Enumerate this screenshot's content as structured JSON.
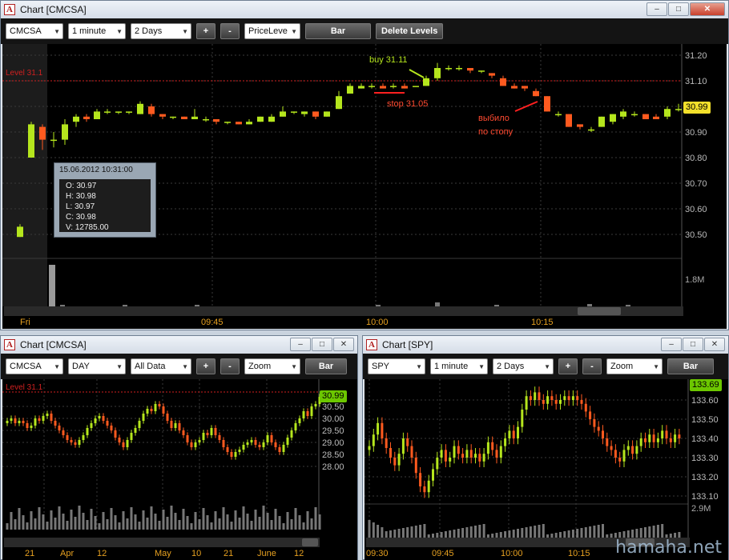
{
  "main": {
    "title": "Chart [CMCSA]",
    "symbol": "CMCSA",
    "interval": "1 minute",
    "period": "2 Days",
    "mode": "PriceLeve",
    "bar_label": "Bar",
    "delete_label": "Delete Levels",
    "plus": "+",
    "minus": "-",
    "level_label": "Level 31.1",
    "price_labels": [
      "31.20",
      "31.10",
      "31.00",
      "30.90",
      "30.80",
      "30.70",
      "30.60",
      "30.50"
    ],
    "price_values": [
      31.2,
      31.1,
      31.0,
      30.9,
      30.8,
      30.7,
      30.6,
      30.5
    ],
    "volume_label": "1.8M",
    "time_labels": [
      "Fri",
      "09:45",
      "10:00",
      "10:15"
    ],
    "current_price": "30.99",
    "buy_note": "buy 31.11",
    "stop_note": "stop 31.05",
    "hit_note_1": "выбило",
    "hit_note_2": "по стопу",
    "tooltip": {
      "title": "15.06.2012 10:31:00",
      "open": "O: 30.97",
      "high": "H: 30.98",
      "low": "L: 30.97",
      "close": "C: 30.98",
      "volume": "V:  12785.00"
    },
    "colors": {
      "up": "#b5e61d",
      "down": "#ff5a1f",
      "level": "#d02020",
      "axis": "#e6a020"
    }
  },
  "left": {
    "title": "Chart [CMCSA]",
    "symbol": "CMCSA",
    "interval": "DAY",
    "period": "All Data",
    "mode": "Zoom",
    "bar_label": "Bar",
    "plus": "+",
    "minus": "-",
    "level_label": "Level 31.1",
    "price_labels": [
      "30.50",
      "30.00",
      "29.50",
      "29.00",
      "28.50",
      "28.00"
    ],
    "current_price": "30.99",
    "time_labels": [
      "21",
      "Apr",
      "12",
      "May",
      "10",
      "21",
      "June",
      "12"
    ]
  },
  "right": {
    "title": "Chart [SPY]",
    "symbol": "SPY",
    "interval": "1 minute",
    "period": "2 Days",
    "mode": "Zoom",
    "bar_label": "Bar",
    "plus": "+",
    "minus": "-",
    "price_labels": [
      "133.60",
      "133.50",
      "133.40",
      "133.30",
      "133.20",
      "133.10"
    ],
    "current_price": "133.69",
    "volume_label": "2.9M",
    "time_labels": [
      "09:30",
      "09:45",
      "10:00",
      "10:15"
    ]
  },
  "watermark": "hamaha.net"
}
